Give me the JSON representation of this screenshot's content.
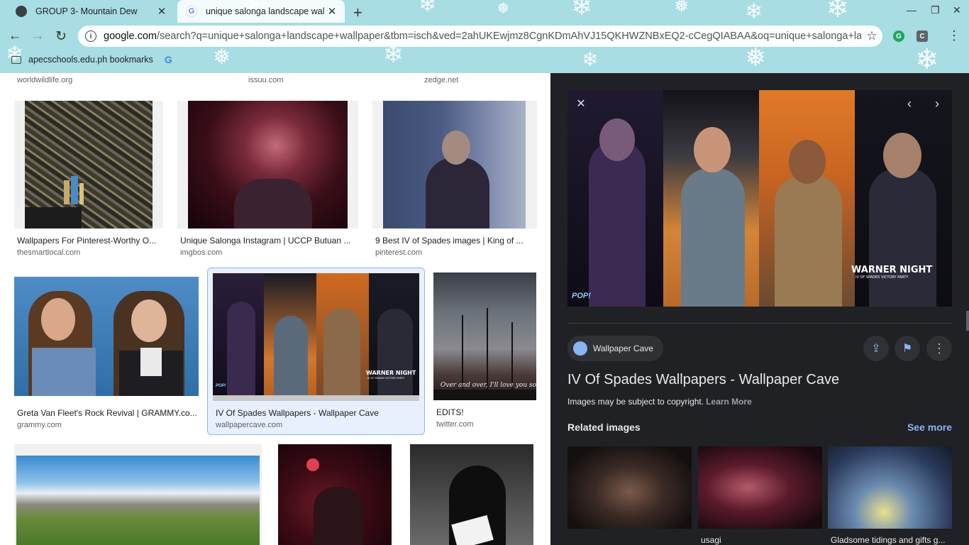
{
  "browser": {
    "tabs": [
      {
        "title": "GROUP 3- Mountain Dew",
        "active": false,
        "icon": "globe-icon"
      },
      {
        "title": "unique salonga landscape wallp",
        "active": true,
        "icon": "google-icon"
      }
    ],
    "new_tab_icon": "+",
    "address": {
      "host": "google.com",
      "path": "/search?q=unique+salonga+landscape+wallpaper&tbm=isch&ved=2ahUKEwjmz8CgnKDmAhVJ15QKHWZNBxEQ2-cCegQIABAA&oq=unique+salonga+lands..."
    },
    "bookmarks": [
      {
        "label": "apecschools.edu.ph bookmarks"
      }
    ],
    "bookmark_g": "G",
    "ext_g": "G",
    "ext_c": "C",
    "info_icon": "i"
  },
  "results": {
    "top_sources": [
      "worldwildlife.org",
      "issuu.com",
      "zedge.net"
    ],
    "row1": [
      {
        "caption": "Wallpapers For Pinterest-Worthy O...",
        "source": "thesmartlocal.com"
      },
      {
        "caption": "Unique Salonga Instagram | UCCP Butuan ...",
        "source": "imgbos.com"
      },
      {
        "caption": "9 Best IV of Spades images | King of ...",
        "source": "pinterest.com"
      }
    ],
    "row2": [
      {
        "caption": "Greta Van Fleet's Rock Revival | GRAMMY.co...",
        "source": "grammy.com"
      },
      {
        "caption": "IV Of Spades Wallpapers - Wallpaper Cave",
        "source": "wallpapercave.com",
        "selected": true
      },
      {
        "caption": "EDITS!",
        "source": "twitter.com"
      }
    ]
  },
  "preview": {
    "image_text_main": "WARNER NIGHT",
    "image_text_sub": "IV OF SPADES VICTORY PARTY",
    "image_text_pop": "POP!",
    "site_name": "Wallpaper Cave",
    "title": "IV Of Spades Wallpapers - Wallpaper Cave",
    "copyright": "Images may be subject to copyright.",
    "learn_more": "Learn More",
    "related_label": "Related images",
    "see_more": "See more",
    "related": [
      {
        "caption": ""
      },
      {
        "caption": "usagi"
      },
      {
        "caption": "Gladsome tidings and gifts g..."
      }
    ]
  },
  "selected_thumb_text": {
    "main": "WARNER NIGHT",
    "sub": "IV OF SPADES VICTORY PARTY",
    "pop": "POP!"
  },
  "edits_thumb_text": "Over and over, I'll love you so tender",
  "colors": {
    "chrome_bg": "#a7dde3",
    "panel_bg": "#202124",
    "link_blue": "#8ab4f8",
    "selected_bg": "#e8f0fe"
  }
}
